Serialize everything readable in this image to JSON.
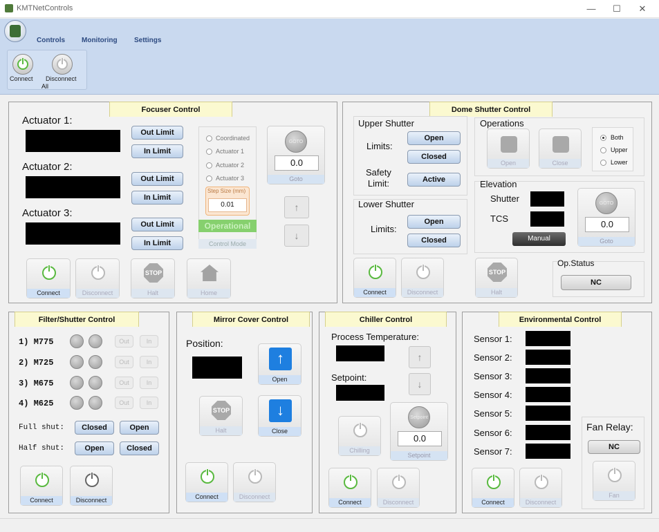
{
  "window": {
    "title": "KMTNetControls",
    "min": "—",
    "max": "☐",
    "close": "✕"
  },
  "ribbon": {
    "tabs": [
      "Controls",
      "Monitoring",
      "Settings"
    ],
    "connect": "Connect",
    "disconnect": "Disconnect",
    "group": "All"
  },
  "focuser": {
    "title": "Focuser Control",
    "actuators": [
      {
        "label": "Actuator 1:",
        "out": "Out Limit",
        "in": "In Limit"
      },
      {
        "label": "Actuator 2:",
        "out": "Out Limit",
        "in": "In Limit"
      },
      {
        "label": "Actuator 3:",
        "out": "Out Limit",
        "in": "In Limit"
      }
    ],
    "modes": [
      "Coordinated",
      "Actuator 1",
      "Actuator 2",
      "Actuator 3"
    ],
    "step_label": "Step Size (mm)",
    "step_value": "0.01",
    "status": "Operational",
    "control_mode": "Control Mode",
    "goto_knob": "GOTO",
    "goto_value": "0.0",
    "goto_label": "Goto",
    "up": "↑",
    "down": "↓",
    "connect": "Connect",
    "disconnect": "Disconnect",
    "halt": "Halt",
    "stop": "STOP",
    "home": "Home"
  },
  "dome": {
    "title": "Dome Shutter Control",
    "upper": {
      "title": "Upper Shutter",
      "limits": "Limits:",
      "open": "Open",
      "closed": "Closed",
      "safety": "Safety\nLimit:",
      "active": "Active"
    },
    "lower": {
      "title": "Lower Shutter",
      "limits": "Limits:",
      "open": "Open",
      "closed": "Closed"
    },
    "ops": {
      "title": "Operations",
      "open": "Open",
      "close": "Close",
      "radios": [
        "Both",
        "Upper",
        "Lower"
      ]
    },
    "elev": {
      "title": "Elevation",
      "shutter": "Shutter",
      "tcs": "TCS",
      "manual": "Manual",
      "goto_knob": "GOTO",
      "goto_value": "0.0",
      "goto_label": "Goto"
    },
    "opstatus": {
      "title": "Op.Status",
      "value": "NC"
    },
    "connect": "Connect",
    "disconnect": "Disconnect",
    "halt": "Halt",
    "stop": "STOP"
  },
  "filter": {
    "title": "Filter/Shutter Control",
    "rows": [
      {
        "label": "1) M775",
        "out": "Out",
        "in": "In"
      },
      {
        "label": "2) M725",
        "out": "Out",
        "in": "In"
      },
      {
        "label": "3) M675",
        "out": "Out",
        "in": "In"
      },
      {
        "label": "4) M625",
        "out": "Out",
        "in": "In"
      }
    ],
    "full": {
      "label": "Full shut:",
      "closed": "Closed",
      "open": "Open"
    },
    "half": {
      "label": "Half shut:",
      "open": "Open",
      "closed": "Closed"
    },
    "connect": "Connect",
    "disconnect": "Disconnect"
  },
  "mirror": {
    "title": "Mirror Cover Control",
    "position": "Position:",
    "open": "Open",
    "close": "Close",
    "halt": "Halt",
    "stop": "STOP",
    "connect": "Connect",
    "disconnect": "Disconnect"
  },
  "chiller": {
    "title": "Chiller Control",
    "process": "Process Temperature:",
    "setpoint": "Setpoint:",
    "chilling": "Chilling",
    "setpoint_knob": "Setpoint",
    "setpoint_value": "0.0",
    "setpoint_label": "Setpoint",
    "up": "↑",
    "down": "↓",
    "connect": "Connect",
    "disconnect": "Disconnect"
  },
  "env": {
    "title": "Environmental Control",
    "sensors": [
      "Sensor 1:",
      "Sensor 2:",
      "Sensor 3:",
      "Sensor 4:",
      "Sensor 5:",
      "Sensor 6:",
      "Sensor 7:"
    ],
    "fan_title": "Fan Relay:",
    "fan_value": "NC",
    "fan": "Fan",
    "connect": "Connect",
    "disconnect": "Disconnect"
  }
}
